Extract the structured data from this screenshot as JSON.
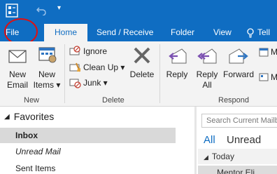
{
  "title_bar": {
    "qat_more_glyph": "▾"
  },
  "tabs": [
    "File",
    "Home",
    "Send / Receive",
    "Folder",
    "View",
    "Tell"
  ],
  "active_tab": "Home",
  "ribbon": {
    "new_group": {
      "new_email": [
        "New",
        "Email"
      ],
      "new_items": [
        "New",
        "Items ▾"
      ],
      "label": "New"
    },
    "delete_group": {
      "ignore": "Ignore",
      "clean_up": "Clean Up ▾",
      "junk": "Junk ▾",
      "delete": "Delete",
      "label": "Delete"
    },
    "respond_group": {
      "reply": "Reply",
      "reply_all": [
        "Reply",
        "All"
      ],
      "forward": "Forward",
      "more_top": "M",
      "more_bottom": "M",
      "label": "Respond"
    }
  },
  "nav": {
    "favorites": "Favorites",
    "items": [
      "Inbox",
      "Unread Mail",
      "Sent Items"
    ]
  },
  "list": {
    "search_placeholder": "Search Current Mailbox",
    "filter_all": "All",
    "filter_unread": "Unread",
    "group_header": "Today",
    "first_sender": "Mentor Eli"
  },
  "colors": {
    "brand_blue": "#0f6dc2",
    "ribbon_bg": "#f3f3f3",
    "annotation_red": "#e01010"
  }
}
